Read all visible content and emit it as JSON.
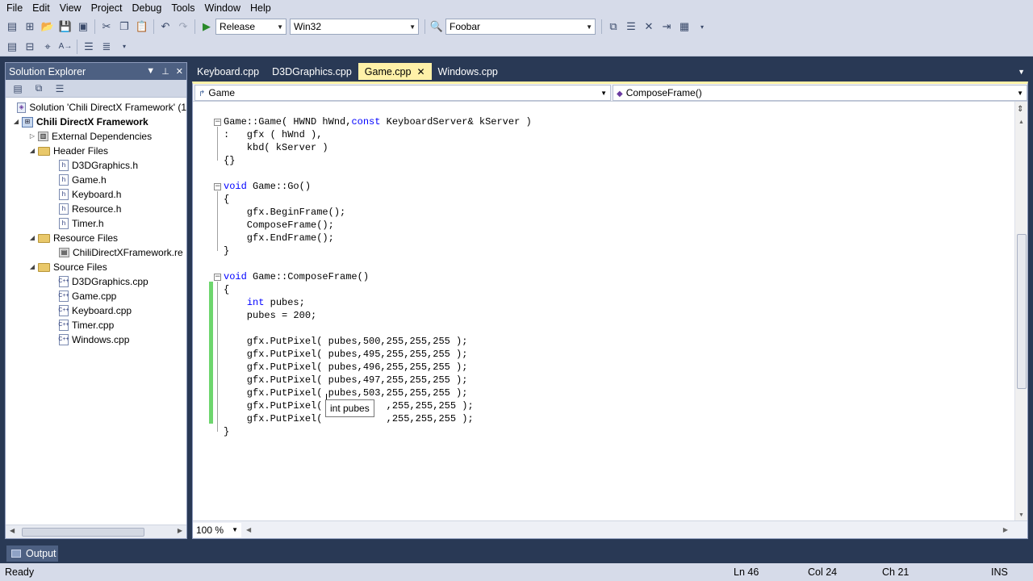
{
  "menu": [
    "File",
    "Edit",
    "View",
    "Project",
    "Debug",
    "Tools",
    "Window",
    "Help"
  ],
  "toolbar": {
    "configuration": "Release",
    "platform": "Win32",
    "find_text": "Foobar"
  },
  "solution_explorer": {
    "title": "Solution Explorer",
    "solution": "Solution 'Chili DirectX Framework' (1",
    "project": "Chili DirectX Framework",
    "external_dependencies": "External Dependencies",
    "header_folder": "Header Files",
    "header_files": [
      "D3DGraphics.h",
      "Game.h",
      "Keyboard.h",
      "Resource.h",
      "Timer.h"
    ],
    "resource_folder": "Resource Files",
    "resource_files": [
      "ChiliDirectXFramework.re"
    ],
    "source_folder": "Source Files",
    "source_files": [
      "D3DGraphics.cpp",
      "Game.cpp",
      "Keyboard.cpp",
      "Timer.cpp",
      "Windows.cpp"
    ]
  },
  "tabs": [
    "Keyboard.cpp",
    "D3DGraphics.cpp",
    "Game.cpp",
    "Windows.cpp"
  ],
  "active_tab": "Game.cpp",
  "navigation": {
    "scope": "Game",
    "member": "ComposeFrame()"
  },
  "code_lines": [
    "Game::Game( HWND hWnd,const KeyboardServer& kServer )",
    ":   gfx ( hWnd ),",
    "    kbd( kServer )",
    "{}",
    "",
    "void Game::Go()",
    "{",
    "    gfx.BeginFrame();",
    "    ComposeFrame();",
    "    gfx.EndFrame();",
    "}",
    "",
    "void Game::ComposeFrame()",
    "{",
    "    int pubes;",
    "    pubes = 200;",
    "",
    "    gfx.PutPixel( pubes,500,255,255,255 );",
    "    gfx.PutPixel( pubes,495,255,255,255 );",
    "    gfx.PutPixel( pubes,496,255,255,255 );",
    "    gfx.PutPixel( pubes,497,255,255,255 );",
    "    gfx.PutPixel( pubes,503,255,255,255 );",
    "    gfx.PutPixel(           ,255,255,255 );",
    "    gfx.PutPixel(           ,255,255,255 );",
    "}"
  ],
  "tooltip": "int pubes",
  "zoom": "100 %",
  "output_tab": "Output",
  "status": {
    "text": "Ready",
    "line": "Ln 46",
    "col": "Col 24",
    "ch": "Ch 21",
    "mode": "INS"
  }
}
